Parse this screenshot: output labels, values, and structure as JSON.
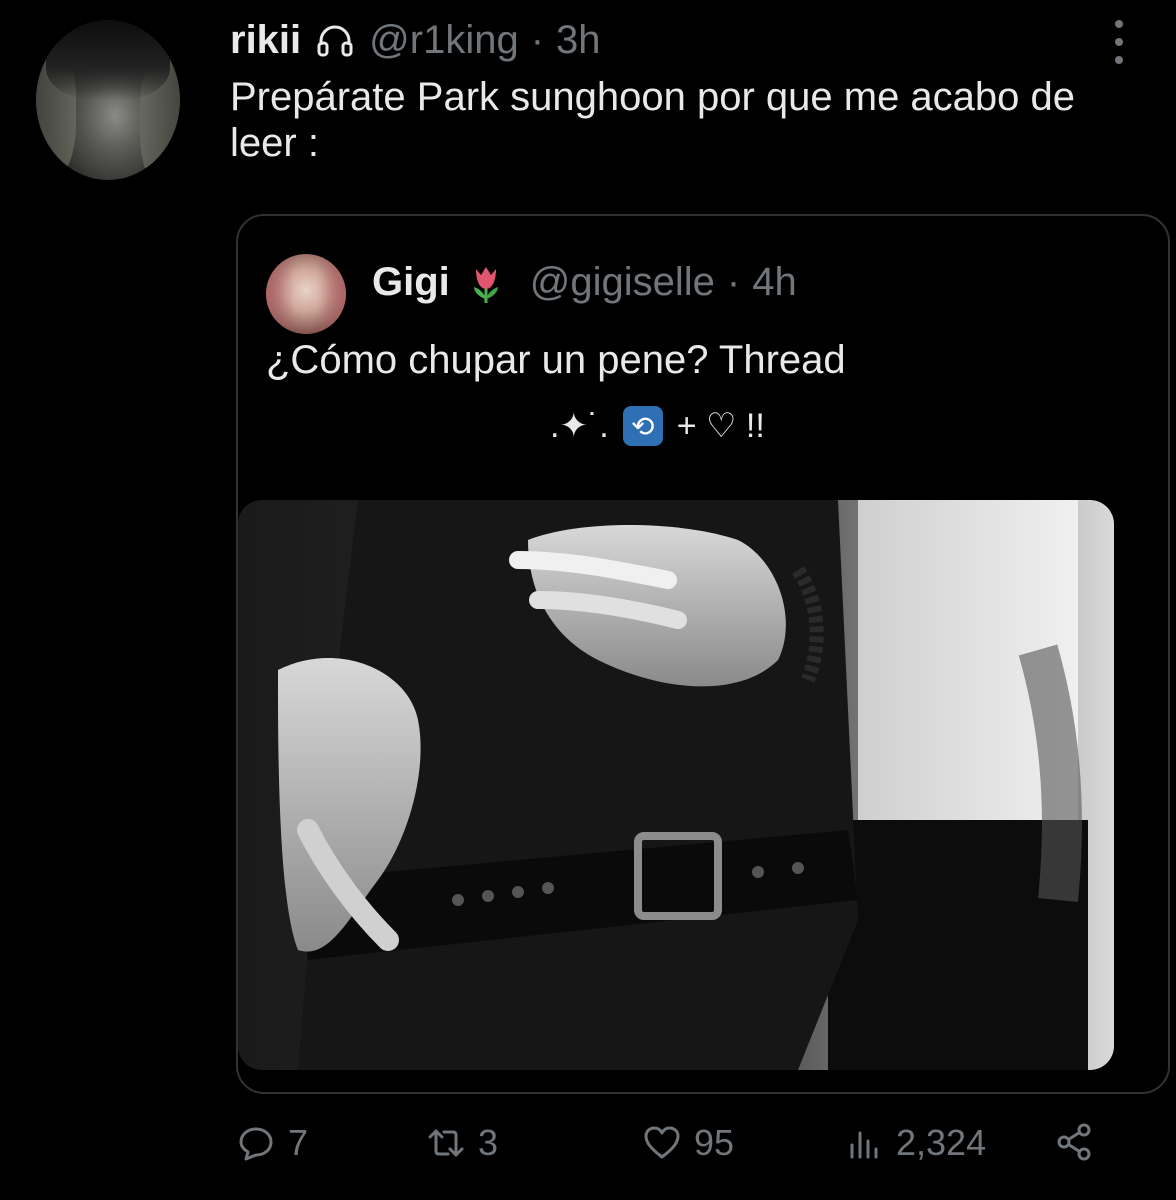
{
  "tweet": {
    "name": "rikii",
    "handle": "@r1king",
    "separator": "·",
    "time": "3h",
    "text": "Prepárate Park sunghoon por que me acabo de leer :"
  },
  "quote": {
    "name": "Gigi",
    "handle": "@gigiselle",
    "separator": "·",
    "time": "4h",
    "text": "¿Cómo chupar un pene? Thread",
    "line2_prefix": ".✦˙.",
    "line2_suffix": "+ ♡ !!"
  },
  "stats": {
    "replies": "7",
    "retweets": "3",
    "likes": "95",
    "views": "2,324"
  },
  "icons": {
    "reply": "reply-icon",
    "retweet": "retweet-icon",
    "like": "heart-icon",
    "views": "views-icon",
    "share": "share-icon",
    "more": "more-vertical-icon",
    "name_emoji": "headphones-icon",
    "quote_name_emoji": "tulip-icon"
  },
  "colors": {
    "background": "#000000",
    "text": "#e7e9ea",
    "muted": "#71767b",
    "border": "#2f3336"
  }
}
